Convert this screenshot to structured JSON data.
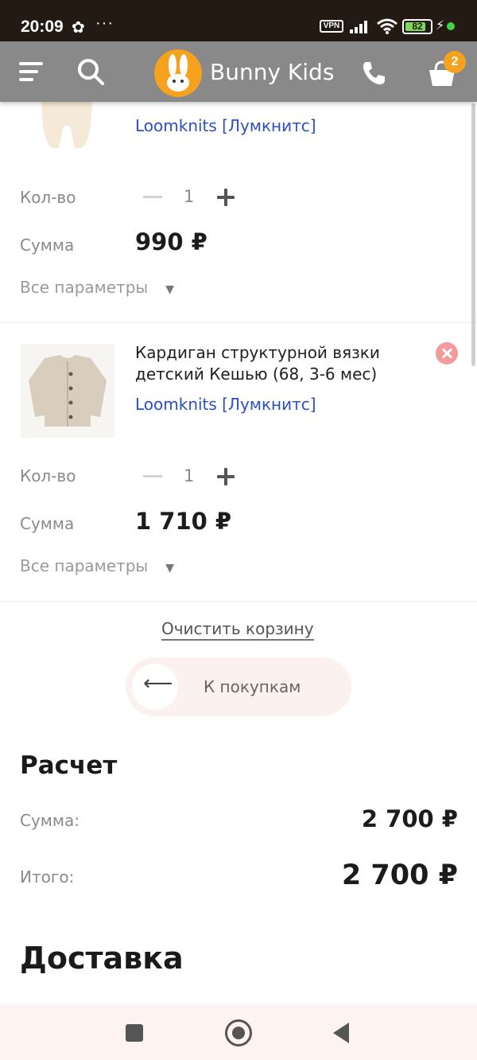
{
  "status_bar": {
    "time": "20:09",
    "vpn": "VPN",
    "battery": "82",
    "battery_level": 0.82
  },
  "header": {
    "brand": "Bunny Kids",
    "cart_count": "2",
    "accent_color": "#f6a21e"
  },
  "cart": {
    "items": [
      {
        "brand": "Loomknits [Лумкнитс]",
        "qty_label": "Кол-во",
        "qty": "1",
        "sum_label": "Сумма",
        "sum": "990 ₽",
        "params_label": "Все параметры"
      },
      {
        "title": "Кардиган структурной вязки детский Кешью (68, 3-6 мес)",
        "brand": "Loomknits [Лумкнитс]",
        "qty_label": "Кол-во",
        "qty": "1",
        "sum_label": "Сумма",
        "sum": "1 710 ₽",
        "params_label": "Все параметры"
      }
    ],
    "clear_label": "Очистить корзину",
    "back_label": "К покупкам"
  },
  "calc": {
    "title": "Расчет",
    "sum_label": "Сумма:",
    "sum_value": "2 700 ₽",
    "total_label": "Итого:",
    "total_value": "2 700 ₽"
  },
  "delivery": {
    "title": "Доставка"
  },
  "icons": {
    "menu": "hamburger-menu-icon",
    "search": "search-icon",
    "phone": "phone-icon",
    "cart": "cart-icon",
    "remove": "remove-icon",
    "back_arrow": "arrow-left-icon"
  }
}
